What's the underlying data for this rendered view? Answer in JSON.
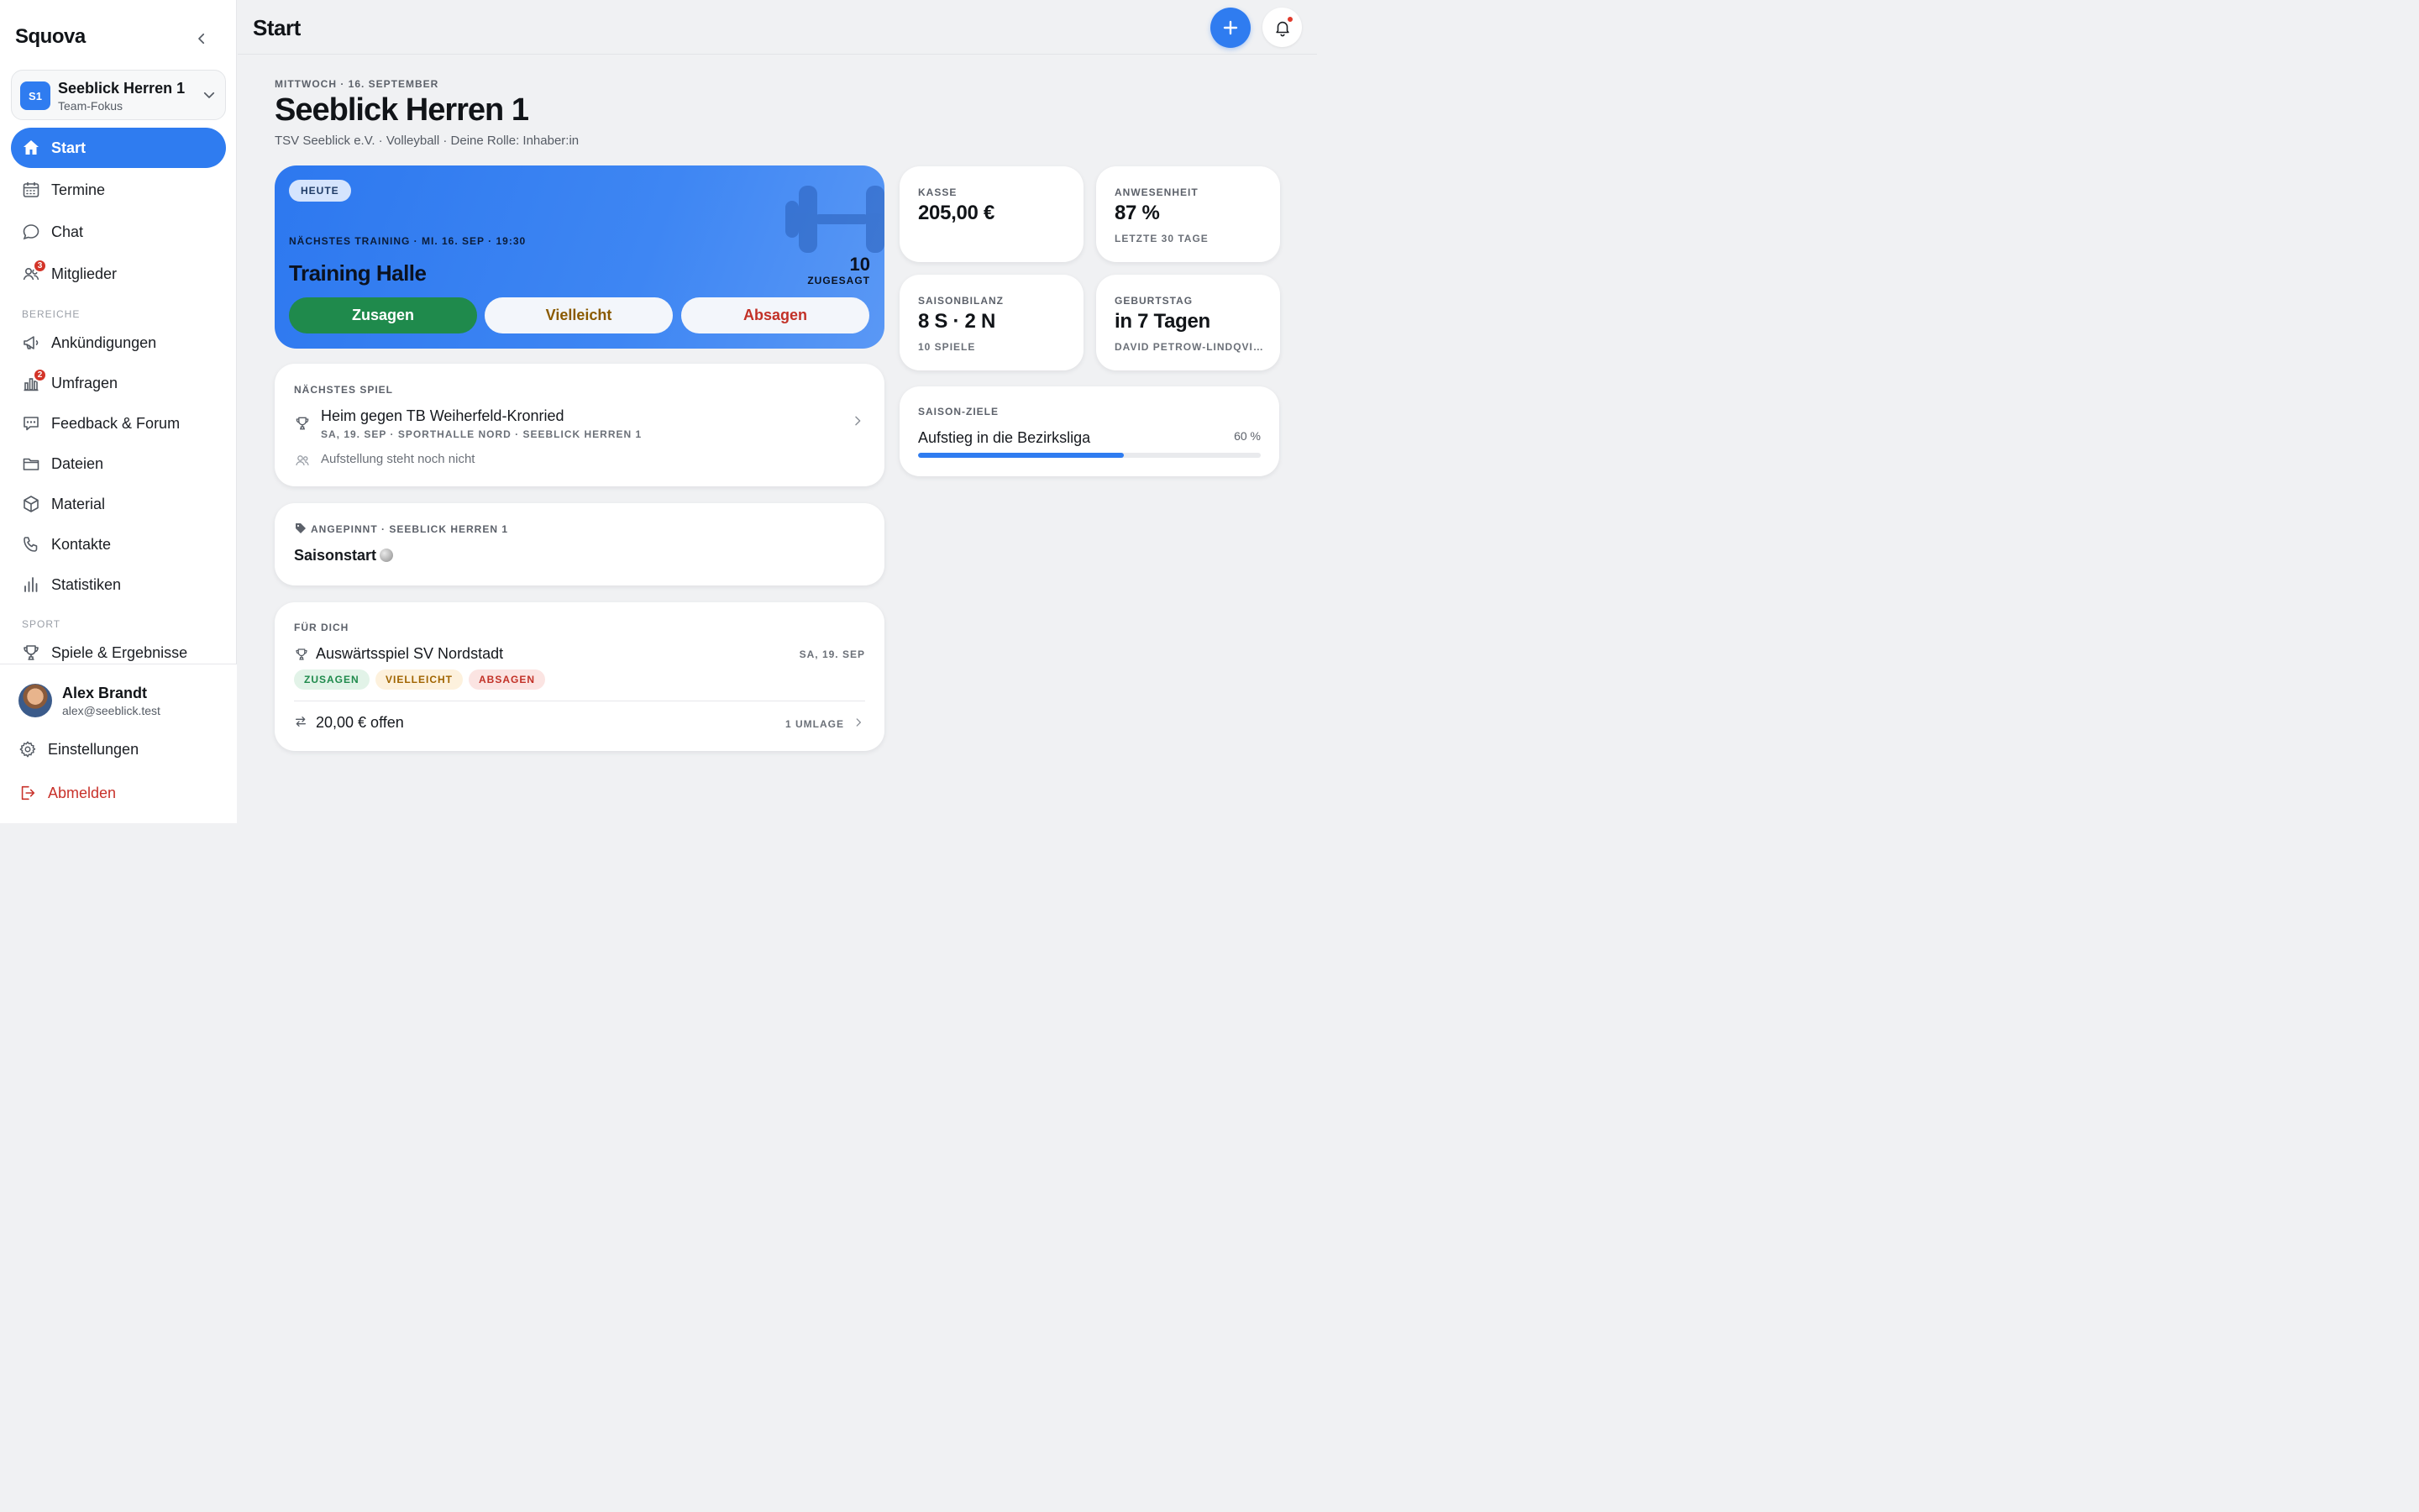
{
  "app": {
    "brand": "Squova",
    "page_title": "Start"
  },
  "team_switcher": {
    "badge": "S1",
    "name": "Seeblick Herren 1",
    "subtitle": "Team-Fokus"
  },
  "nav": {
    "items": [
      {
        "label": "Start",
        "icon": "home-icon",
        "active": true
      },
      {
        "label": "Termine",
        "icon": "calendar-icon"
      },
      {
        "label": "Chat",
        "icon": "chat-bubble-icon"
      },
      {
        "label": "Mitglieder",
        "icon": "members-icon",
        "badge": "3"
      }
    ],
    "section_bereiche": "BEREICHE",
    "bereiche": [
      {
        "label": "Ankündigungen",
        "icon": "megaphone-icon"
      },
      {
        "label": "Umfragen",
        "icon": "poll-icon",
        "badge": "2"
      },
      {
        "label": "Feedback & Forum",
        "icon": "forum-icon"
      },
      {
        "label": "Dateien",
        "icon": "folder-icon"
      },
      {
        "label": "Material",
        "icon": "box-icon"
      },
      {
        "label": "Kontakte",
        "icon": "phone-icon"
      },
      {
        "label": "Statistiken",
        "icon": "bar-chart-icon"
      }
    ],
    "section_sport": "SPORT",
    "sport": [
      {
        "label": "Spiele & Ergebnisse",
        "icon": "trophy-icon"
      }
    ]
  },
  "user": {
    "name": "Alex Brandt",
    "email": "alex@seeblick.test"
  },
  "footer": {
    "settings_label": "Einstellungen",
    "logout_label": "Abmelden"
  },
  "header": {
    "date": "MITTWOCH · 16. SEPTEMBER",
    "team": "Seeblick Herren 1",
    "meta": "TSV Seeblick e.V. · Volleyball · Deine Rolle: Inhaber:in"
  },
  "training": {
    "pill": "HEUTE",
    "overline": "NÄCHSTES TRAINING · MI. 16. SEP · 19:30",
    "title": "Training Halle",
    "count": "10",
    "count_label": "ZUGESAGT",
    "yes_label": "Zusagen",
    "maybe_label": "Vielleicht",
    "no_label": "Absagen"
  },
  "next_game": {
    "overline": "NÄCHSTES SPIEL",
    "title": "Heim gegen TB Weiherfeld-Kronried",
    "details": "SA, 19. SEP · SPORTHALLE NORD · SEEBLICK HERREN 1",
    "lineup": "Aufstellung steht noch nicht"
  },
  "pinned": {
    "overline": "ANGEPINNT · SEEBLICK HERREN 1",
    "title": "Saisonstart"
  },
  "for_you": {
    "overline": "FÜR DICH",
    "event_title": "Auswärtsspiel SV Nordstadt",
    "event_date": "SA, 19. SEP",
    "chip_yes": "ZUSAGEN",
    "chip_maybe": "VIELLEICHT",
    "chip_no": "ABSAGEN",
    "open_amount": "20,00 € offen",
    "umlage": "1 UMLAGE"
  },
  "stats": {
    "kasse": {
      "label": "KASSE",
      "value": "205,00 €"
    },
    "anwesenheit": {
      "label": "ANWESENHEIT",
      "value": "87 %",
      "sub": "LETZTE 30 TAGE"
    },
    "saisonbilanz": {
      "label": "SAISONBILANZ",
      "value": "8 S · 2 N",
      "sub": "10 SPIELE"
    },
    "geburtstag": {
      "label": "GEBURTSTAG",
      "value": "in 7 Tagen",
      "sub": "DAVID PETROW-LINDQVI…"
    }
  },
  "goals": {
    "label": "SAISON-ZIELE",
    "goal": "Aufstieg in die Bezirksliga",
    "percent_label": "60 %",
    "progress": 0.6
  },
  "colors": {
    "accent": "#2f7cf0",
    "success": "#1f8a4c",
    "warning": "#a06400",
    "danger": "#c23127"
  }
}
